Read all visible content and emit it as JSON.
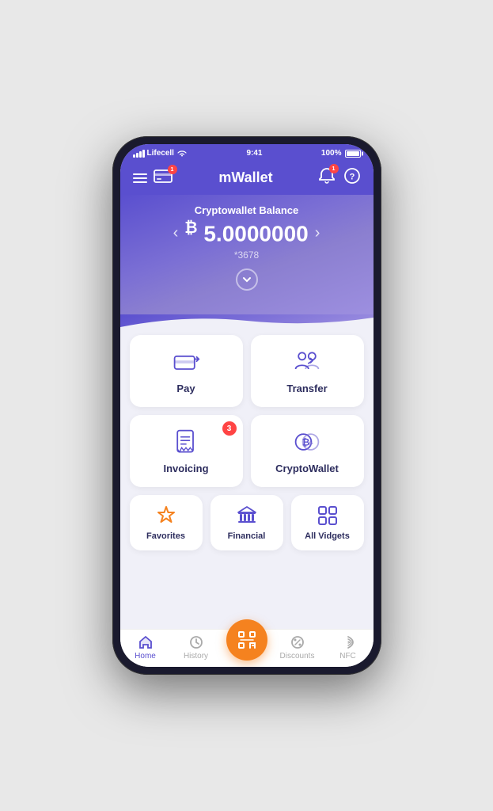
{
  "status_bar": {
    "carrier": "Lifecell",
    "time": "9:41",
    "battery": "100%"
  },
  "header": {
    "title": "mWallet",
    "notification_badge": "1"
  },
  "balance": {
    "label": "Cryptowallet Balance",
    "currency_symbol": "₿",
    "amount": "5.0000000",
    "account_suffix": "*3678"
  },
  "actions": [
    {
      "id": "pay",
      "label": "Pay",
      "icon": "pay-icon",
      "badge": null
    },
    {
      "id": "transfer",
      "label": "Transfer",
      "icon": "transfer-icon",
      "badge": null
    },
    {
      "id": "invoicing",
      "label": "Invoicing",
      "icon": "invoicing-icon",
      "badge": "3"
    },
    {
      "id": "cryptowallet",
      "label": "CryptoWallet",
      "icon": "crypto-icon",
      "badge": null
    }
  ],
  "quick_actions": [
    {
      "id": "favorites",
      "label": "Favorites",
      "icon": "star-icon",
      "color": "#f5821f"
    },
    {
      "id": "financial",
      "label": "Financial",
      "icon": "bank-icon",
      "color": "#5a4fcf"
    },
    {
      "id": "all_vidgets",
      "label": "All Vidgets",
      "icon": "grid-icon",
      "color": "#5a4fcf"
    }
  ],
  "bottom_nav": [
    {
      "id": "home",
      "label": "Home",
      "icon": "home-icon",
      "active": true
    },
    {
      "id": "history",
      "label": "History",
      "icon": "history-icon",
      "active": false
    },
    {
      "id": "scan",
      "label": "",
      "icon": "scan-icon",
      "active": false,
      "center": true
    },
    {
      "id": "discounts",
      "label": "Discounts",
      "icon": "discounts-icon",
      "active": false
    },
    {
      "id": "nfc",
      "label": "NFC",
      "icon": "nfc-icon",
      "active": false
    }
  ]
}
